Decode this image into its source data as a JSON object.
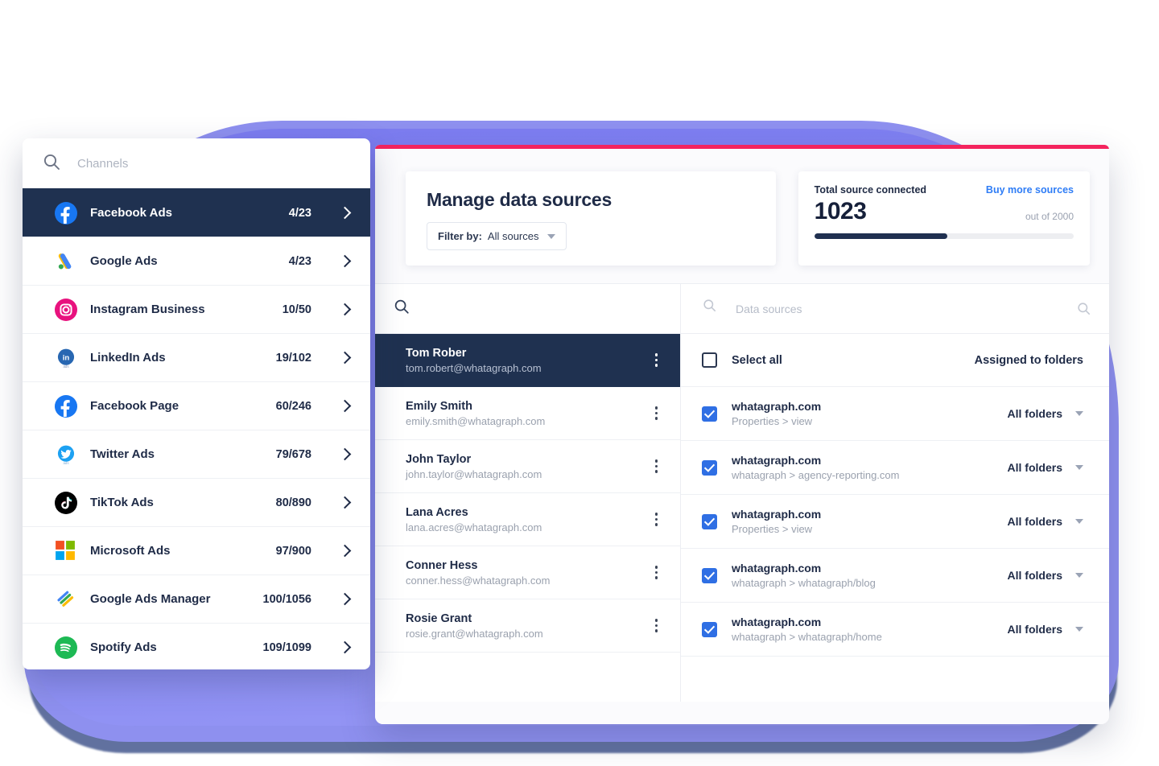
{
  "background": {
    "blob_color": "#8385f2",
    "blob_shadow_color": "#46598f"
  },
  "app_window": {
    "accent_color": "#f4245e",
    "header": {
      "title": "Manage data sources",
      "filter": {
        "label": "Filter by:",
        "value": "All sources",
        "icon": "chevron-down-icon"
      }
    },
    "total_sources_card": {
      "label": "Total source connected",
      "buy_link": "Buy more sources",
      "count": "1023",
      "out_of": "out of 2000",
      "progress_percent": 51.15,
      "bar_color": "#203050"
    },
    "users_pane": {
      "search_placeholder": "",
      "search_icon": "search-icon",
      "rows": [
        {
          "name": "Tom Rober",
          "email": "tom.robert@whatagraph.com",
          "selected": true
        },
        {
          "name": "Emily Smith",
          "email": "emily.smith@whatagraph.com",
          "selected": false
        },
        {
          "name": "John Taylor",
          "email": "john.taylor@whatagraph.com",
          "selected": false
        },
        {
          "name": "Lana Acres",
          "email": "lana.acres@whatagraph.com",
          "selected": false
        },
        {
          "name": "Conner Hess",
          "email": "conner.hess@whatagraph.com",
          "selected": false
        },
        {
          "name": "Rosie Grant",
          "email": "rosie.grant@whatagraph.com",
          "selected": false
        }
      ]
    },
    "sources_pane": {
      "search_placeholder": "Data sources",
      "search_icon": "search-icon",
      "filter_icon": "search-icon",
      "select_all_label": "Select all",
      "select_all_checked": false,
      "assigned_header": "Assigned to folders",
      "rows": [
        {
          "name": "whatagraph.com",
          "path": "Properties > view",
          "checked": true,
          "folder": "All folders"
        },
        {
          "name": "whatagraph.com",
          "path": "whatagraph > agency-reporting.com",
          "checked": true,
          "folder": "All folders"
        },
        {
          "name": "whatagraph.com",
          "path": "Properties > view",
          "checked": true,
          "folder": "All folders"
        },
        {
          "name": "whatagraph.com",
          "path": "whatagraph > whatagraph/blog",
          "checked": true,
          "folder": "All folders"
        },
        {
          "name": "whatagraph.com",
          "path": "whatagraph > whatagraph/home",
          "checked": true,
          "folder": "All folders"
        }
      ]
    }
  },
  "channels_popover": {
    "search_placeholder": "Channels",
    "search_icon": "search-icon",
    "items": [
      {
        "label": "Facebook Ads",
        "count": "4/23",
        "icon": "facebook-ads-icon",
        "selected": true
      },
      {
        "label": "Google Ads",
        "count": "4/23",
        "icon": "google-ads-icon",
        "selected": false
      },
      {
        "label": "Instagram Business",
        "count": "10/50",
        "icon": "instagram-icon",
        "selected": false
      },
      {
        "label": "LinkedIn Ads",
        "count": "19/102",
        "icon": "linkedin-ads-icon",
        "selected": false
      },
      {
        "label": "Facebook Page",
        "count": "60/246",
        "icon": "facebook-page-icon",
        "selected": false
      },
      {
        "label": "Twitter Ads",
        "count": "79/678",
        "icon": "twitter-ads-icon",
        "selected": false
      },
      {
        "label": "TikTok Ads",
        "count": "80/890",
        "icon": "tiktok-ads-icon",
        "selected": false
      },
      {
        "label": "Microsoft Ads",
        "count": "97/900",
        "icon": "microsoft-ads-icon",
        "selected": false
      },
      {
        "label": "Google Ads Manager",
        "count": "100/1056",
        "icon": "google-ads-manager-icon",
        "selected": false
      },
      {
        "label": "Spotify Ads",
        "count": "109/1099",
        "icon": "spotify-ads-icon",
        "selected": false
      }
    ]
  }
}
